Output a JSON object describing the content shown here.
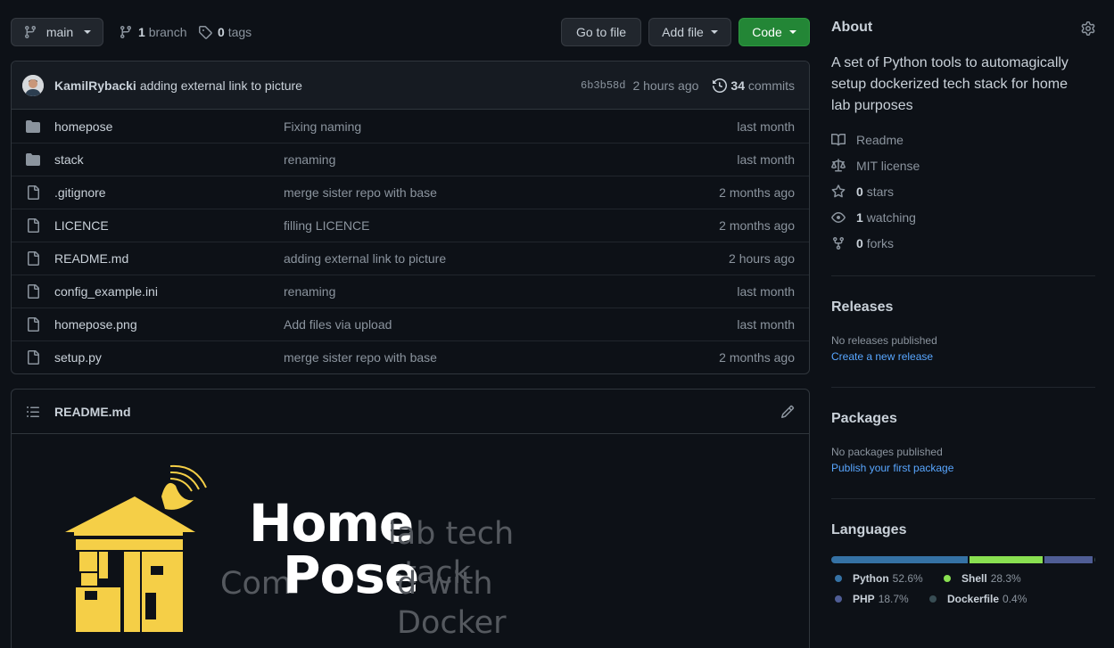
{
  "toolbar": {
    "branch_name": "main",
    "branches_count": "1",
    "branches_label": "branch",
    "tags_count": "0",
    "tags_label": "tags",
    "go_to_file": "Go to file",
    "add_file": "Add file",
    "code": "Code"
  },
  "commit": {
    "author": "KamilRybacki",
    "message": "adding external link to picture",
    "sha": "6b3b58d",
    "time": "2 hours ago",
    "commits_count": "34",
    "commits_label": "commits"
  },
  "files": [
    {
      "type": "folder-icon",
      "name": "homepose",
      "message": "Fixing naming",
      "age": "last month"
    },
    {
      "type": "folder-icon",
      "name": "stack",
      "message": "renaming",
      "age": "last month"
    },
    {
      "type": "file-icon",
      "name": ".gitignore",
      "message": "merge sister repo with base",
      "age": "2 months ago"
    },
    {
      "type": "file-icon",
      "name": "LICENCE",
      "message": "filling LICENCE",
      "age": "2 months ago"
    },
    {
      "type": "file-icon",
      "name": "README.md",
      "message": "adding external link to picture",
      "age": "2 hours ago"
    },
    {
      "type": "file-icon",
      "name": "config_example.ini",
      "message": "renaming",
      "age": "last month"
    },
    {
      "type": "file-icon",
      "name": "homepose.png",
      "message": "Add files via upload",
      "age": "last month"
    },
    {
      "type": "file-icon",
      "name": "setup.py",
      "message": "merge sister repo with base",
      "age": "2 months ago"
    }
  ],
  "readme": {
    "title": "README.md",
    "logo": {
      "word_home": "Home",
      "word_pose": "Pose",
      "tail_1": "lab tech stack",
      "lead_2": "Com",
      "tail_2": "d with Docker"
    }
  },
  "about": {
    "heading": "About",
    "description": "A set of Python tools to automagically setup dockerized tech stack for home lab purposes",
    "readme": "Readme",
    "license": "MIT license",
    "stars_count": "0",
    "stars_label": "stars",
    "watching_count": "1",
    "watching_label": "watching",
    "forks_count": "0",
    "forks_label": "forks"
  },
  "releases": {
    "heading": "Releases",
    "empty": "No releases published",
    "link": "Create a new release"
  },
  "packages": {
    "heading": "Packages",
    "empty": "No packages published",
    "link": "Publish your first package"
  },
  "languages": {
    "heading": "Languages",
    "items": [
      {
        "name": "Python",
        "percent": "52.6%",
        "value": 52.6,
        "color": "#3572A5"
      },
      {
        "name": "Shell",
        "percent": "28.3%",
        "value": 28.3,
        "color": "#89e051"
      },
      {
        "name": "PHP",
        "percent": "18.7%",
        "value": 18.7,
        "color": "#4F5D95"
      },
      {
        "name": "Dockerfile",
        "percent": "0.4%",
        "value": 0.4,
        "color": "#384d54"
      }
    ]
  },
  "colors": {
    "background": "#0d1117",
    "accent_link": "#58a6ff",
    "code_button": "#238636",
    "logo_yellow": "#f5cf47"
  }
}
